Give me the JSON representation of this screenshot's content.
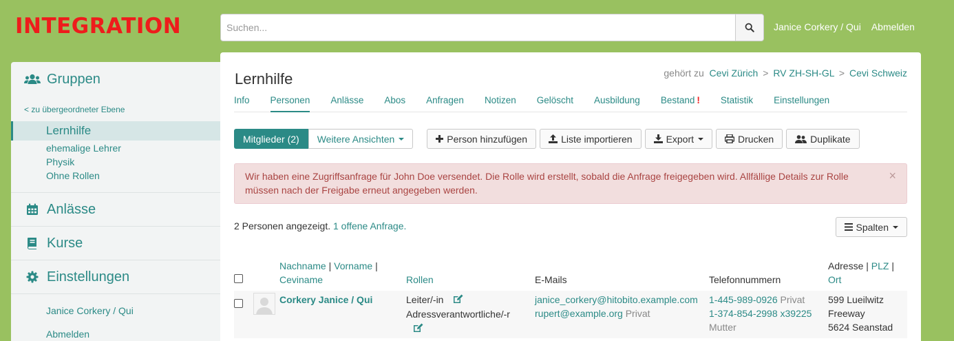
{
  "header": {
    "brand": "INTEGRATION",
    "search_placeholder": "Suchen...",
    "user": "Janice Corkery / Qui",
    "logout": "Abmelden"
  },
  "sidebar": {
    "groups_label": "Gruppen",
    "up_link": "< zu übergeordneter Ebene",
    "items": [
      {
        "label": "Lernhilfe",
        "active": true
      },
      {
        "label": "ehemalige Lehrer"
      },
      {
        "label": "Physik"
      },
      {
        "label": "Ohne Rollen"
      }
    ],
    "events_label": "Anlässe",
    "courses_label": "Kurse",
    "settings_label": "Einstellungen",
    "user": "Janice Corkery / Qui",
    "logout": "Abmelden"
  },
  "main": {
    "title": "Lernhilfe",
    "belongs_prefix": "gehört zu",
    "breadcrumb": [
      "Cevi Zürich",
      "RV ZH-SH-GL",
      "Cevi Schweiz"
    ],
    "breadcrumb_sep": ">",
    "tabs": [
      "Info",
      "Personen",
      "Anlässe",
      "Abos",
      "Anfragen",
      "Notizen",
      "Gelöscht",
      "Ausbildung",
      "Bestand",
      "Statistik",
      "Einstellungen"
    ],
    "tab_bestand_mark": "!",
    "buttons": {
      "members": "Mitglieder (2)",
      "more_views": "Weitere Ansichten",
      "add_person": "Person hinzufügen",
      "import": "Liste importieren",
      "export": "Export",
      "print": "Drucken",
      "duplicates": "Duplikate",
      "columns": "Spalten"
    },
    "alert": "Wir haben eine Zugriffsanfrage für John Doe versendet. Die Rolle wird erstellt, sobald die Anfrage freigegeben wird. Allfällige Details zur Rolle müssen nach der Freigabe erneut angegeben werden.",
    "alert_close": "×",
    "count_text": "2 Personen angezeigt.",
    "open_requests": "1 offene Anfrage.",
    "table": {
      "headers": {
        "nachname": "Nachname",
        "vorname": "Vorname",
        "ceviname": "Ceviname",
        "rollen": "Rollen",
        "emails": "E-Mails",
        "phones": "Telefonnummern",
        "adresse": "Adresse",
        "plz": "PLZ",
        "ort": "Ort",
        "sep": "|"
      },
      "rows": [
        {
          "name": "Corkery Janice / Qui",
          "role1": "Leiter/-in",
          "role2": "Adressverantwortliche/-r",
          "email1": "janice_corkery@hitobito.example.com",
          "email2": "rupert@example.org",
          "email2_label": "Privat",
          "phone1": "1-445-989-0926",
          "phone1_label": "Privat",
          "phone2": "1-374-854-2998 x39225",
          "phone2_label": "Mutter",
          "addr1": "599 Lueilwitz",
          "addr2": "Freeway",
          "addr3": "5624 Seanstad"
        }
      ]
    }
  }
}
